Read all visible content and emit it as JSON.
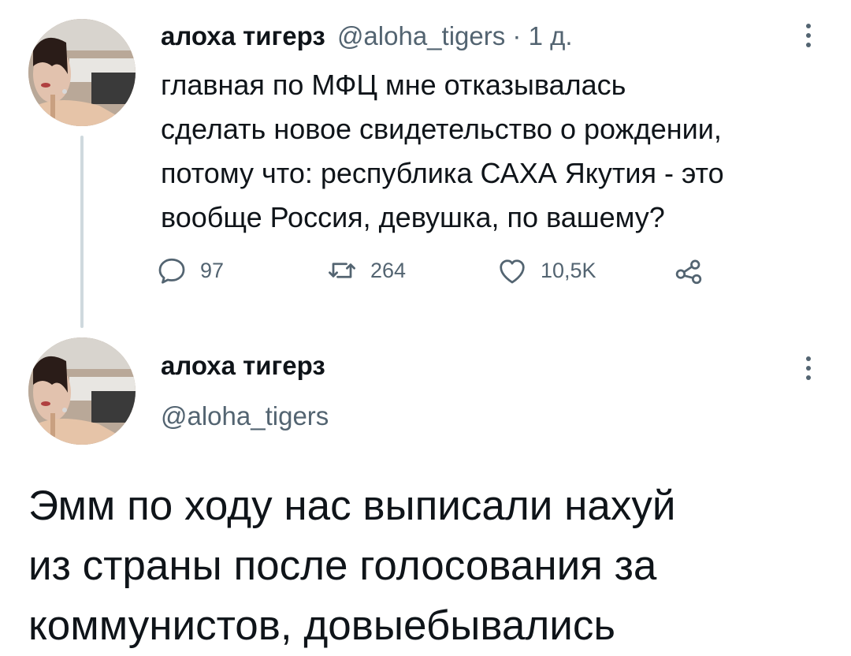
{
  "tweet1": {
    "display_name": "алоха тигерз",
    "handle": "@aloha_tigers",
    "separator": " · ",
    "time": "1 д.",
    "text_lines": [
      "главная по МФЦ мне отказывалась",
      "сделать новое свидетельство о рождении,",
      "потому что: республика САХА Якутия - это",
      "вообще Россия, девушка, по вашему?"
    ],
    "actions": {
      "reply_count": "97",
      "retweet_count": "264",
      "like_count": "10,5K"
    }
  },
  "tweet2": {
    "display_name": "алоха тигерз",
    "handle": "@aloha_tigers",
    "text_lines": [
      "Эмм по ходу нас выписали нахуй",
      "из страны после голосования за",
      "коммунистов, довыебывались"
    ]
  },
  "icons": {
    "reply": "reply-icon",
    "retweet": "retweet-icon",
    "like": "heart-icon",
    "share": "share-icon",
    "more": "more-vertical-icon"
  },
  "colors": {
    "text": "#0f1419",
    "muted": "#536471",
    "thread_line": "#cfd9de"
  }
}
